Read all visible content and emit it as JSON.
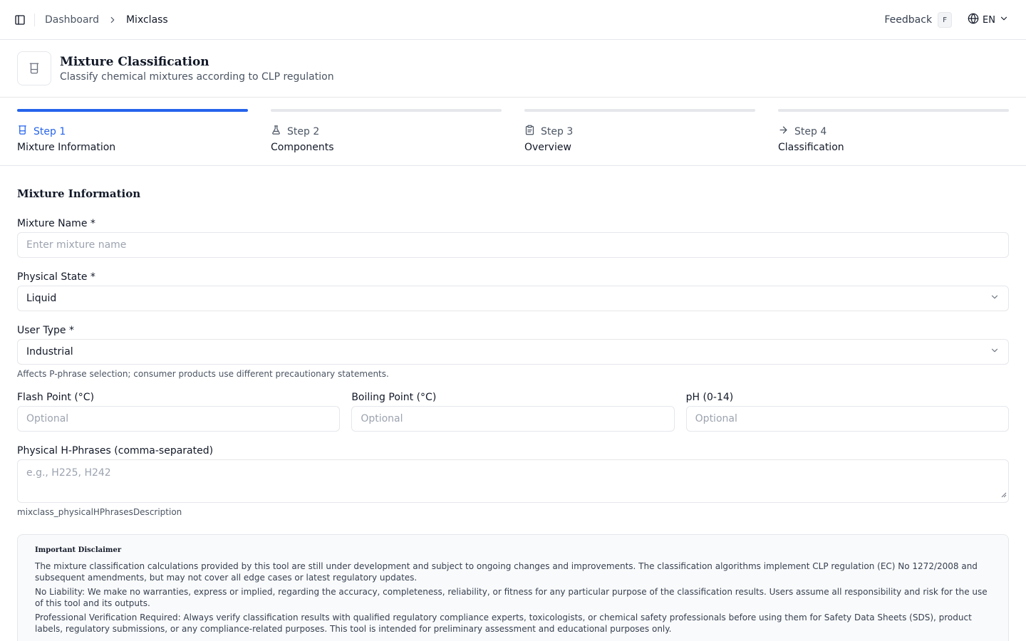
{
  "breadcrumb": {
    "home": "Dashboard",
    "current": "Mixclass"
  },
  "topbar": {
    "feedback": "Feedback",
    "feedback_shortcut": "F",
    "language": "EN"
  },
  "header": {
    "title": "Mixture Classification",
    "subtitle": "Classify chemical mixtures according to CLP regulation"
  },
  "steps": [
    {
      "label": "Step 1",
      "name": "Mixture Information",
      "icon": "beaker-icon",
      "active": true
    },
    {
      "label": "Step 2",
      "name": "Components",
      "icon": "flask-icon",
      "active": false
    },
    {
      "label": "Step 3",
      "name": "Overview",
      "icon": "clipboard-icon",
      "active": false
    },
    {
      "label": "Step 4",
      "name": "Classification",
      "icon": "arrow-right-icon",
      "active": false
    }
  ],
  "form": {
    "section_title": "Mixture Information",
    "mixture_name": {
      "label": "Mixture Name *",
      "placeholder": "Enter mixture name",
      "value": ""
    },
    "physical_state": {
      "label": "Physical State *",
      "value": "Liquid"
    },
    "user_type": {
      "label": "User Type *",
      "value": "Industrial",
      "helper": "Affects P-phrase selection; consumer products use different precautionary statements."
    },
    "flash_point": {
      "label": "Flash Point (°C)",
      "placeholder": "Optional"
    },
    "boiling_point": {
      "label": "Boiling Point (°C)",
      "placeholder": "Optional"
    },
    "ph": {
      "label": "pH (0-14)",
      "placeholder": "Optional"
    },
    "h_phrases": {
      "label": "Physical H-Phrases (comma-separated)",
      "placeholder": "e.g., H225, H242",
      "helper": "mixclass_physicalHPhrasesDescription"
    }
  },
  "disclaimer": {
    "title": "Important Disclaimer",
    "p1": "The mixture classification calculations provided by this tool are still under development and subject to ongoing changes and improvements. The classification algorithms implement CLP regulation (EC) No 1272/2008 and subsequent amendments, but may not cover all edge cases or latest regulatory updates.",
    "p2": "No Liability: We make no warranties, express or implied, regarding the accuracy, completeness, reliability, or fitness for any particular purpose of the classification results. Users assume all responsibility and risk for the use of this tool and its outputs.",
    "p3": "Professional Verification Required: Always verify classification results with qualified regulatory compliance experts, toxicologists, or chemical safety professionals before using them for Safety Data Sheets (SDS), product labels, regulatory submissions, or any compliance-related purposes. This tool is intended for preliminary assessment and educational purposes only."
  },
  "colors": {
    "accent": "#2563eb",
    "border": "#e5e7eb",
    "muted": "#4b5563"
  }
}
